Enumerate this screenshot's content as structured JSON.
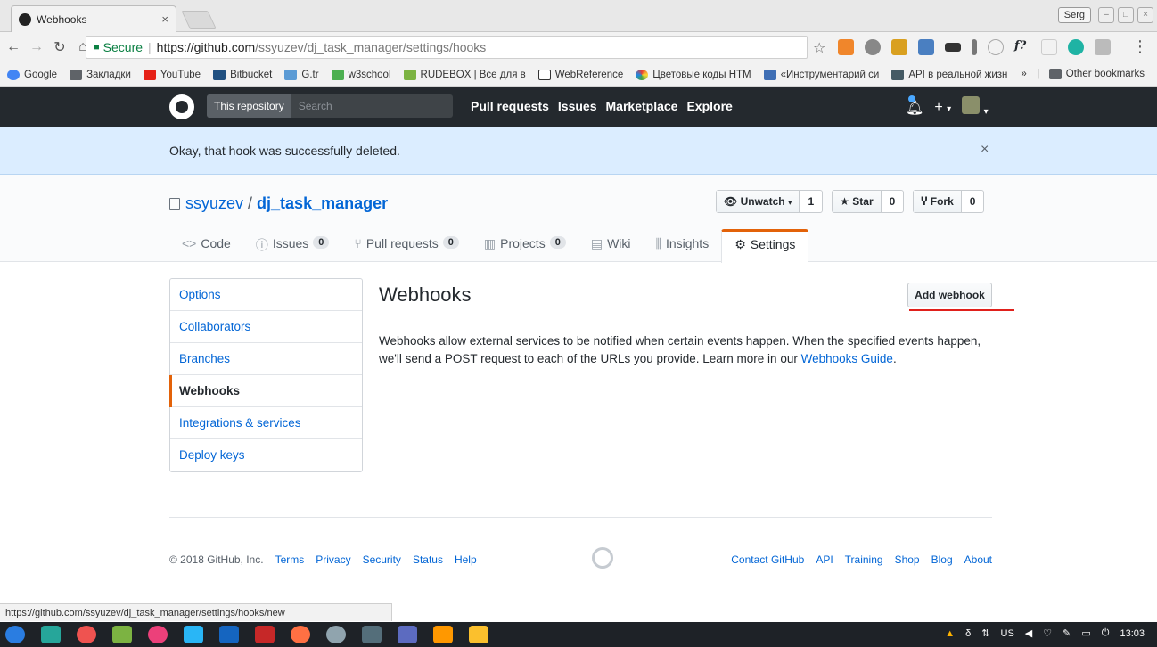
{
  "browser": {
    "tab_title": "Webhooks",
    "tab_close": "×",
    "user": "Serg",
    "secure_label": "Secure",
    "url_host": "https://github.com",
    "url_path": "/ssyuzev/dj_task_manager/settings/hooks",
    "bookmarks": [
      "Google",
      "Закладки",
      "YouTube",
      "Bitbucket",
      "G.tr",
      "w3school",
      "RUDEBOX | Все для в",
      "WebReference",
      "Цветовые коды HTM",
      "«Инструментарий си",
      "API в реальной жизн"
    ],
    "bookmarks_more": "»",
    "other_bookmarks": "Other bookmarks",
    "status_url": "https://github.com/ssyuzev/dj_task_manager/settings/hooks/new"
  },
  "header": {
    "scope": "This repository",
    "search_placeholder": "Search",
    "nav": [
      "Pull requests",
      "Issues",
      "Marketplace",
      "Explore"
    ],
    "plus": "+",
    "caret": "▾"
  },
  "flash": {
    "message": "Okay, that hook was successfully deleted.",
    "close": "×"
  },
  "repo": {
    "owner": "ssyuzev",
    "name": "dj_task_manager",
    "watch_label": "Unwatch",
    "watch_count": "1",
    "star_label": "Star",
    "star_count": "0",
    "fork_label": "Fork",
    "fork_count": "0",
    "tabs": {
      "code": "Code",
      "issues": "Issues",
      "issues_count": "0",
      "pulls": "Pull requests",
      "pulls_count": "0",
      "projects": "Projects",
      "projects_count": "0",
      "wiki": "Wiki",
      "insights": "Insights",
      "settings": "Settings"
    }
  },
  "settings_menu": [
    "Options",
    "Collaborators",
    "Branches",
    "Webhooks",
    "Integrations & services",
    "Deploy keys"
  ],
  "webhooks": {
    "title": "Webhooks",
    "add_button": "Add webhook",
    "description": "Webhooks allow external services to be notified when certain events happen. When the specified events happen, we'll send a POST request to each of the URLs you provide. Learn more in our",
    "guide_link": "Webhooks Guide",
    "period": "."
  },
  "footer": {
    "copyright": "© 2018 GitHub, Inc.",
    "left_links": [
      "Terms",
      "Privacy",
      "Security",
      "Status",
      "Help"
    ],
    "right_links": [
      "Contact GitHub",
      "API",
      "Training",
      "Shop",
      "Blog",
      "About"
    ]
  },
  "taskbar": {
    "lang": "US",
    "time": "13:03"
  }
}
